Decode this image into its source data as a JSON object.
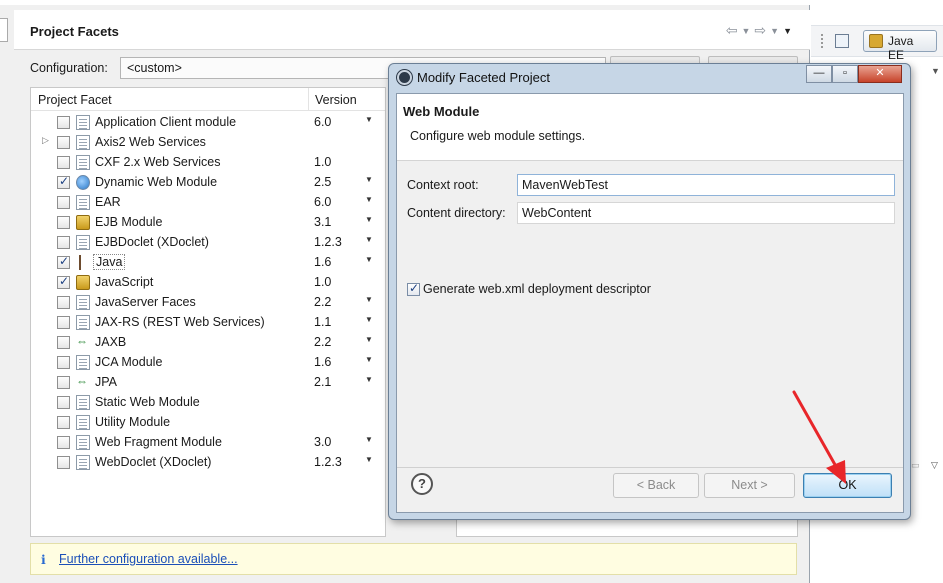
{
  "background": {
    "panel_title": "Project Facets",
    "configuration_label": "Configuration:",
    "configuration_value": "<custom>",
    "table_headers": {
      "facet": "Project Facet",
      "version": "Version"
    },
    "facets": [
      {
        "name": "Application Client module",
        "version": "6.0",
        "checked": false,
        "dropdown": true,
        "expand": false,
        "icon": "doc"
      },
      {
        "name": "Axis2 Web Services",
        "version": "",
        "checked": false,
        "dropdown": false,
        "expand": true,
        "icon": "doc"
      },
      {
        "name": "CXF 2.x Web Services",
        "version": "1.0",
        "checked": false,
        "dropdown": false,
        "expand": false,
        "icon": "doc"
      },
      {
        "name": "Dynamic Web Module",
        "version": "2.5",
        "checked": true,
        "dropdown": true,
        "expand": false,
        "icon": "globe"
      },
      {
        "name": "EAR",
        "version": "6.0",
        "checked": false,
        "dropdown": true,
        "expand": false,
        "icon": "doc"
      },
      {
        "name": "EJB Module",
        "version": "3.1",
        "checked": false,
        "dropdown": true,
        "expand": false,
        "icon": "lock"
      },
      {
        "name": "EJBDoclet (XDoclet)",
        "version": "1.2.3",
        "checked": false,
        "dropdown": true,
        "expand": false,
        "icon": "doc"
      },
      {
        "name": "Java",
        "version": "1.6",
        "checked": true,
        "dropdown": true,
        "expand": false,
        "icon": "java",
        "selected": true
      },
      {
        "name": "JavaScript",
        "version": "1.0",
        "checked": true,
        "dropdown": false,
        "expand": false,
        "icon": "lock"
      },
      {
        "name": "JavaServer Faces",
        "version": "2.2",
        "checked": false,
        "dropdown": true,
        "expand": false,
        "icon": "doc"
      },
      {
        "name": "JAX-RS (REST Web Services)",
        "version": "1.1",
        "checked": false,
        "dropdown": true,
        "expand": false,
        "icon": "doc"
      },
      {
        "name": "JAXB",
        "version": "2.2",
        "checked": false,
        "dropdown": true,
        "expand": false,
        "icon": "arrows"
      },
      {
        "name": "JCA Module",
        "version": "1.6",
        "checked": false,
        "dropdown": true,
        "expand": false,
        "icon": "doc"
      },
      {
        "name": "JPA",
        "version": "2.1",
        "checked": false,
        "dropdown": true,
        "expand": false,
        "icon": "arrows"
      },
      {
        "name": "Static Web Module",
        "version": "",
        "checked": false,
        "dropdown": false,
        "expand": false,
        "icon": "doc"
      },
      {
        "name": "Utility Module",
        "version": "",
        "checked": false,
        "dropdown": false,
        "expand": false,
        "icon": "doc"
      },
      {
        "name": "Web Fragment Module",
        "version": "3.0",
        "checked": false,
        "dropdown": true,
        "expand": false,
        "icon": "doc"
      },
      {
        "name": "WebDoclet (XDoclet)",
        "version": "1.2.3",
        "checked": false,
        "dropdown": true,
        "expand": false,
        "icon": "doc"
      }
    ],
    "info_icon": "i",
    "info_link": "Further configuration available..."
  },
  "ide": {
    "perspective_label": "Java EE"
  },
  "dialog": {
    "title": "Modify Faceted Project",
    "banner_title": "Web Module",
    "banner_subtitle": "Configure web module settings.",
    "context_root_label": "Context root:",
    "context_root_value": "MavenWebTest",
    "content_dir_label": "Content directory:",
    "content_dir_value": "WebContent",
    "generate_label": "Generate web.xml deployment descriptor",
    "generate_checked": true,
    "help_glyph": "?",
    "back_label": "< Back",
    "next_label": "Next >",
    "ok_label": "OK",
    "min_glyph": "—",
    "max_glyph": "▫",
    "close_glyph": "✕"
  },
  "colors": {
    "accent_arrow": "#e8262a",
    "ok_border": "#3c7fb1"
  }
}
